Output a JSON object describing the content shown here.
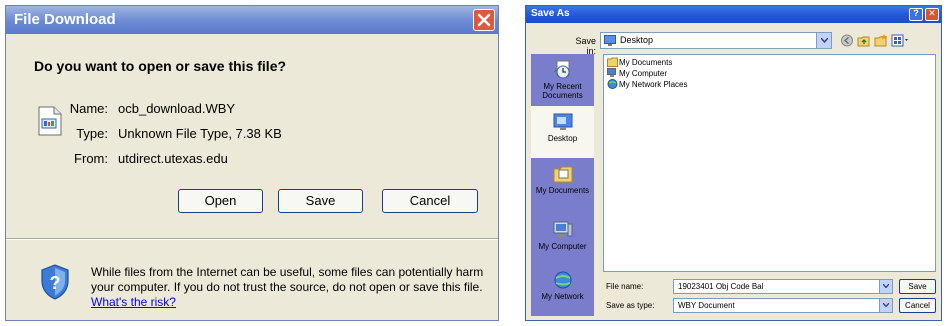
{
  "file_download": {
    "title": "File Download",
    "question": "Do you want to open or save this file?",
    "name_label": "Name:",
    "name_value": "ocb_download.WBY",
    "type_label": "Type:",
    "type_value": "Unknown File Type, 7.38 KB",
    "from_label": "From:",
    "from_value": "utdirect.utexas.edu",
    "open_label": "Open",
    "save_label": "Save",
    "cancel_label": "Cancel",
    "warning_text": "While files from the Internet can be useful, some files can potentially harm your computer. If you do not trust the source, do not open or save this file.",
    "risk_link": "What's the risk?"
  },
  "save_as": {
    "title": "Save As",
    "save_in_label": "Save in:",
    "save_in_value": "Desktop",
    "places": [
      {
        "label": "My Recent Documents"
      },
      {
        "label": "Desktop"
      },
      {
        "label": "My Documents"
      },
      {
        "label": "My Computer"
      },
      {
        "label": "My Network"
      }
    ],
    "files": [
      {
        "name": "My Documents"
      },
      {
        "name": "My Computer"
      },
      {
        "name": "My Network Places"
      }
    ],
    "file_name_label": "File name:",
    "file_name_value": "19023401 Obj Code Bal",
    "save_as_type_label": "Save as type:",
    "save_as_type_value": "WBY Document",
    "save_label": "Save",
    "cancel_label": "Cancel"
  },
  "colors": {
    "dialog_bg": "#ece9d8",
    "fd_titlebar": "#6b8ad2",
    "sa_titlebar": "#1e56d6",
    "places_bar": "#7a7dcc",
    "link": "#0000ff"
  }
}
